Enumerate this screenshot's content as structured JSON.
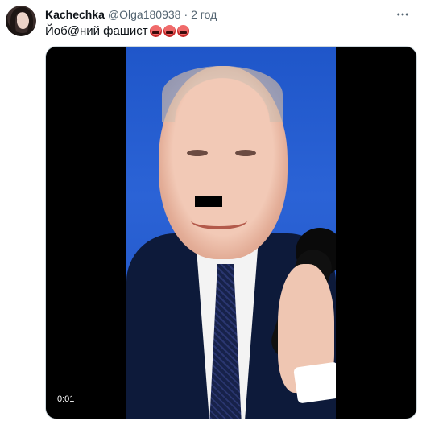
{
  "tweet": {
    "author_name": "Kachechka",
    "author_handle": "@Olga180938",
    "separator": "·",
    "time": "2 год",
    "text": "Йоб@ний фашист",
    "more_icon": "more-icon",
    "emojis": [
      "angry-face-icon",
      "angry-face-icon",
      "angry-face-icon"
    ]
  },
  "media": {
    "type": "video",
    "timestamp": "0:01",
    "background_color": "#2b63d6"
  }
}
